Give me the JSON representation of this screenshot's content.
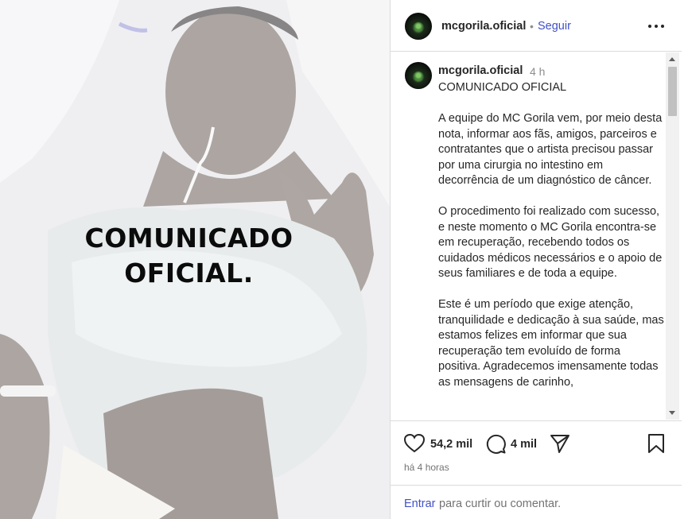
{
  "media": {
    "overlay_line1": "COMUNICADO",
    "overlay_line2": "OFICIAL."
  },
  "header": {
    "username": "mcgorila.oficial",
    "separator": "•",
    "follow_label": "Seguir",
    "more_icon": "more-horizontal-icon"
  },
  "caption": {
    "username": "mcgorila.oficial",
    "time": "4 h",
    "paragraphs": [
      "COMUNICADO OFICIAL",
      "A equipe do MC Gorila vem, por meio desta nota, informar aos fãs, amigos, parceiros e contratantes que o artista precisou passar por uma cirurgia no intestino em decorrência de um diagnóstico de câncer.",
      "O procedimento foi realizado com sucesso, e neste momento o MC Gorila encontra-se em recuperação, recebendo todos os cuidados médicos necessários e o apoio de seus familiares e de toda a equipe.",
      "Este é um período que exige atenção, tranquilidade e dedicação à sua saúde, mas estamos felizes em informar que sua recuperação tem evoluído de forma positiva. Agradecemos imensamente todas as mensagens de carinho,"
    ]
  },
  "actions": {
    "likes": "54,2 mil",
    "comments": "4 mil",
    "icons": [
      "heart-icon",
      "comment-icon",
      "share-icon",
      "bookmark-icon"
    ]
  },
  "time_ago": "há 4 horas",
  "login": {
    "link": "Entrar",
    "rest": "para curtir ou comentar."
  },
  "colors": {
    "link": "#4150c7",
    "border": "#dbdbdb",
    "muted": "#737373"
  }
}
